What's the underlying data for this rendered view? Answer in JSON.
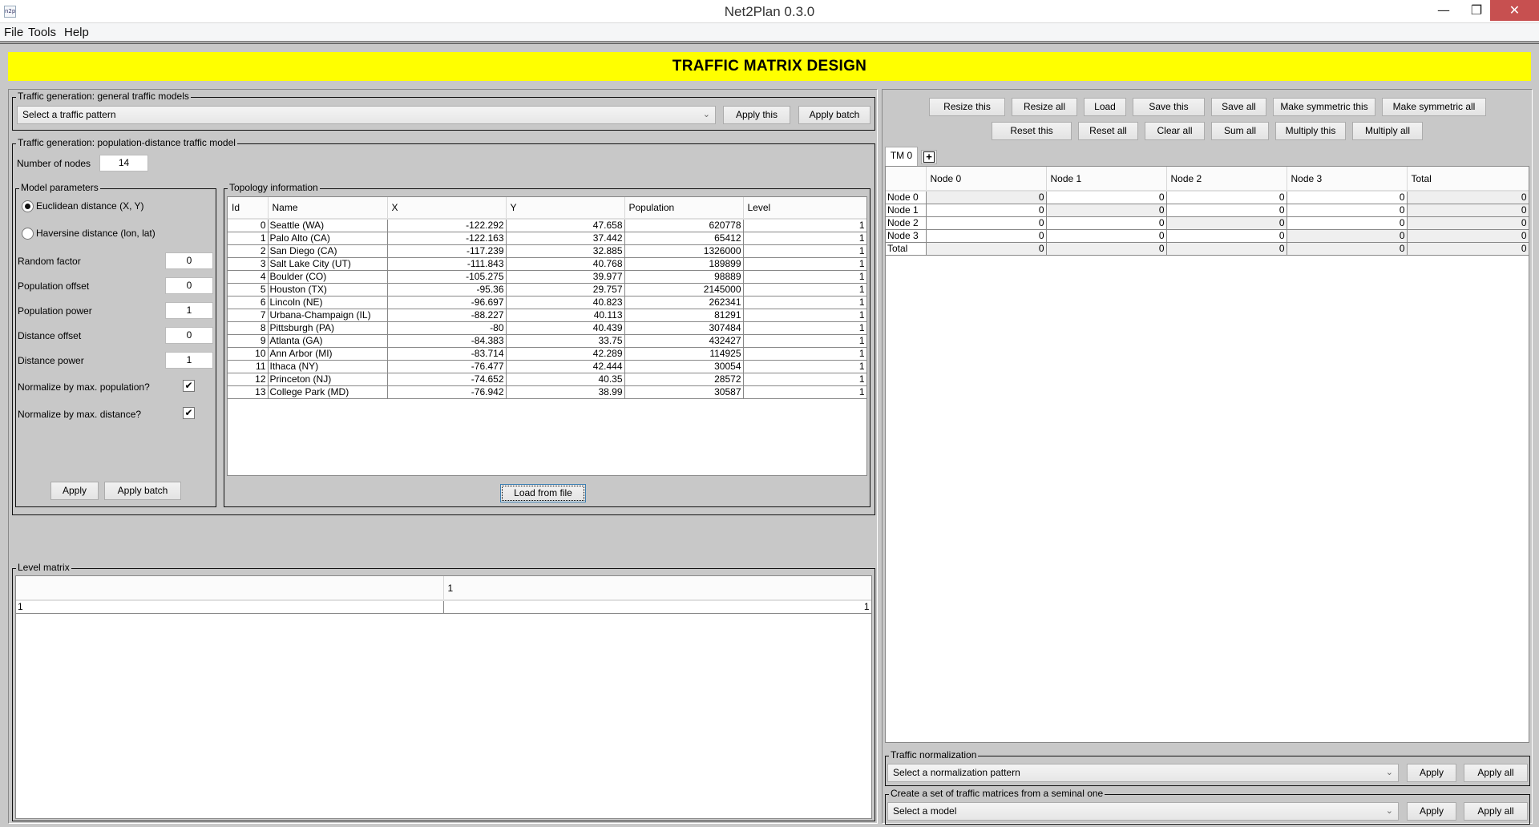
{
  "window": {
    "title": "Net2Plan 0.3.0",
    "app_icon": "n2p",
    "minimize_icon": "—",
    "maximize_icon": "❐",
    "close_icon": "✕"
  },
  "menu": [
    "File",
    "Tools",
    "Help"
  ],
  "banner": "TRAFFIC MATRIX DESIGN",
  "general_models": {
    "title": "Traffic generation: general traffic models",
    "combo_value": "Select a traffic pattern",
    "apply_this": "Apply this",
    "apply_batch": "Apply batch"
  },
  "population_model": {
    "title": "Traffic generation: population-distance traffic model",
    "num_nodes_label": "Number of nodes",
    "num_nodes_value": "14",
    "model_params": {
      "title": "Model parameters",
      "radio_euclidean": "Euclidean distance (X, Y)",
      "radio_haversine": "Haversine distance (lon, lat)",
      "selected": "euclidean",
      "fields": [
        {
          "label": "Random factor",
          "value": "0"
        },
        {
          "label": "Population offset",
          "value": "0"
        },
        {
          "label": "Population power",
          "value": "1"
        },
        {
          "label": "Distance offset",
          "value": "0"
        },
        {
          "label": "Distance power",
          "value": "1"
        }
      ],
      "checks": [
        {
          "label": "Normalize by max. population?",
          "checked": true
        },
        {
          "label": "Normalize by max. distance?",
          "checked": true
        }
      ],
      "apply": "Apply",
      "apply_batch": "Apply batch"
    },
    "topology": {
      "title": "Topology information",
      "columns": [
        "Id",
        "Name",
        "X",
        "Y",
        "Population",
        "Level"
      ],
      "rows": [
        [
          "0",
          "Seattle (WA)",
          "-122.292",
          "47.658",
          "620778",
          "1"
        ],
        [
          "1",
          "Palo Alto (CA)",
          "-122.163",
          "37.442",
          "65412",
          "1"
        ],
        [
          "2",
          "San Diego (CA)",
          "-117.239",
          "32.885",
          "1326000",
          "1"
        ],
        [
          "3",
          "Salt Lake City (UT)",
          "-111.843",
          "40.768",
          "189899",
          "1"
        ],
        [
          "4",
          "Boulder (CO)",
          "-105.275",
          "39.977",
          "98889",
          "1"
        ],
        [
          "5",
          "Houston (TX)",
          "-95.36",
          "29.757",
          "2145000",
          "1"
        ],
        [
          "6",
          "Lincoln (NE)",
          "-96.697",
          "40.823",
          "262341",
          "1"
        ],
        [
          "7",
          "Urbana-Champaign (IL)",
          "-88.227",
          "40.113",
          "81291",
          "1"
        ],
        [
          "8",
          "Pittsburgh (PA)",
          "-80",
          "40.439",
          "307484",
          "1"
        ],
        [
          "9",
          "Atlanta (GA)",
          "-84.383",
          "33.75",
          "432427",
          "1"
        ],
        [
          "10",
          "Ann Arbor (MI)",
          "-83.714",
          "42.289",
          "114925",
          "1"
        ],
        [
          "11",
          "Ithaca (NY)",
          "-76.477",
          "42.444",
          "30054",
          "1"
        ],
        [
          "12",
          "Princeton (NJ)",
          "-74.652",
          "40.35",
          "28572",
          "1"
        ],
        [
          "13",
          "College Park (MD)",
          "-76.942",
          "38.99",
          "30587",
          "1"
        ]
      ],
      "load_button": "Load from file"
    }
  },
  "level_matrix": {
    "title": "Level matrix",
    "columns": [
      "",
      "1"
    ],
    "rows": [
      [
        "1",
        "1"
      ]
    ]
  },
  "matrix_toolbar": {
    "row1": [
      "Resize this",
      "Resize all",
      "Load",
      "Save this",
      "Save all",
      "Make symmetric this",
      "Make symmetric all"
    ],
    "row2": [
      "Reset this",
      "Reset all",
      "Clear all",
      "Sum all",
      "Multiply this",
      "Multiply all"
    ]
  },
  "tabs": [
    {
      "label": "TM 0",
      "active": true
    }
  ],
  "add_tab_icon": "+",
  "traffic_matrix": {
    "columns": [
      "",
      "Node 0",
      "Node 1",
      "Node 2",
      "Node 3",
      "Total"
    ],
    "rows": [
      [
        "Node 0",
        "0",
        "0",
        "0",
        "0",
        "0"
      ],
      [
        "Node 1",
        "0",
        "0",
        "0",
        "0",
        "0"
      ],
      [
        "Node 2",
        "0",
        "0",
        "0",
        "0",
        "0"
      ],
      [
        "Node 3",
        "0",
        "0",
        "0",
        "0",
        "0"
      ],
      [
        "Total",
        "0",
        "0",
        "0",
        "0",
        "0"
      ]
    ]
  },
  "normalization": {
    "title": "Traffic normalization",
    "combo_value": "Select a normalization pattern",
    "apply": "Apply",
    "apply_all": "Apply all"
  },
  "seminal": {
    "title": "Create a set of traffic matrices from a seminal one",
    "combo_value": "Select a model",
    "apply": "Apply",
    "apply_all": "Apply all"
  },
  "colors": {
    "banner": "#ffff00",
    "close_button": "#c75050",
    "background": "#c8c8c8"
  }
}
